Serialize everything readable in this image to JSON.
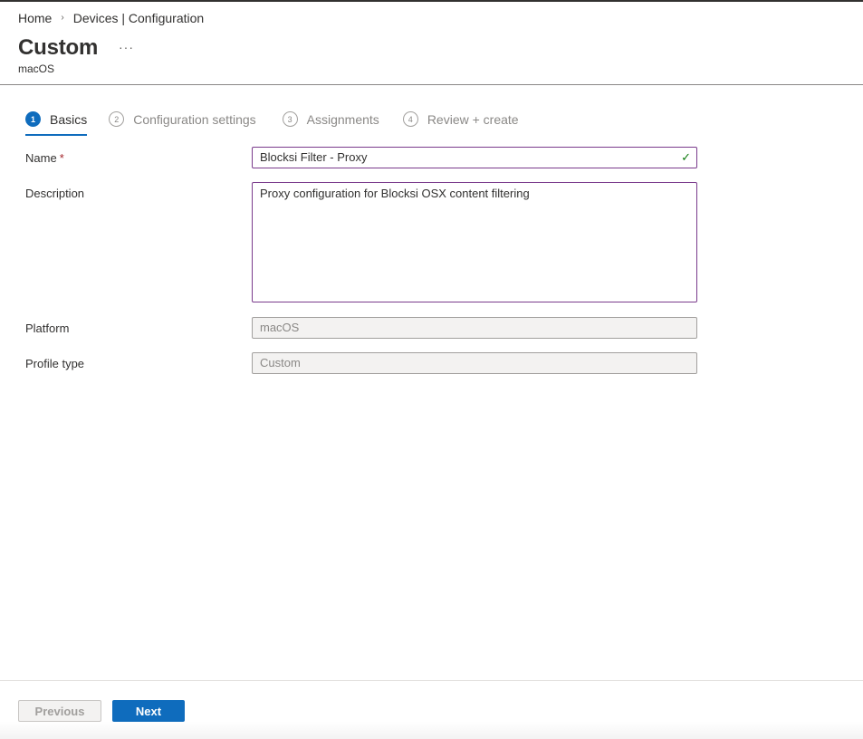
{
  "breadcrumb": {
    "home": "Home",
    "separator": "›",
    "current": "Devices | Configuration"
  },
  "header": {
    "title": "Custom",
    "more": "···",
    "subtitle": "macOS"
  },
  "steps": [
    {
      "num": "1",
      "label": "Basics",
      "active": true
    },
    {
      "num": "2",
      "label": "Configuration settings",
      "active": false
    },
    {
      "num": "3",
      "label": "Assignments",
      "active": false
    },
    {
      "num": "4",
      "label": "Review + create",
      "active": false
    }
  ],
  "form": {
    "name_label": "Name",
    "required_mark": "*",
    "name_value": "Blocksi Filter - Proxy",
    "valid_icon": "check-icon",
    "valid_glyph": "✓",
    "description_label": "Description",
    "description_value": "Proxy configuration for Blocksi OSX content filtering",
    "platform_label": "Platform",
    "platform_value": "macOS",
    "profile_type_label": "Profile type",
    "profile_type_value": "Custom"
  },
  "footer": {
    "previous_label": "Previous",
    "next_label": "Next"
  },
  "colors": {
    "accent": "#0f6cbd",
    "input_border_focus": "#7a3b8c",
    "valid": "#107c10",
    "required": "#a4262c"
  }
}
